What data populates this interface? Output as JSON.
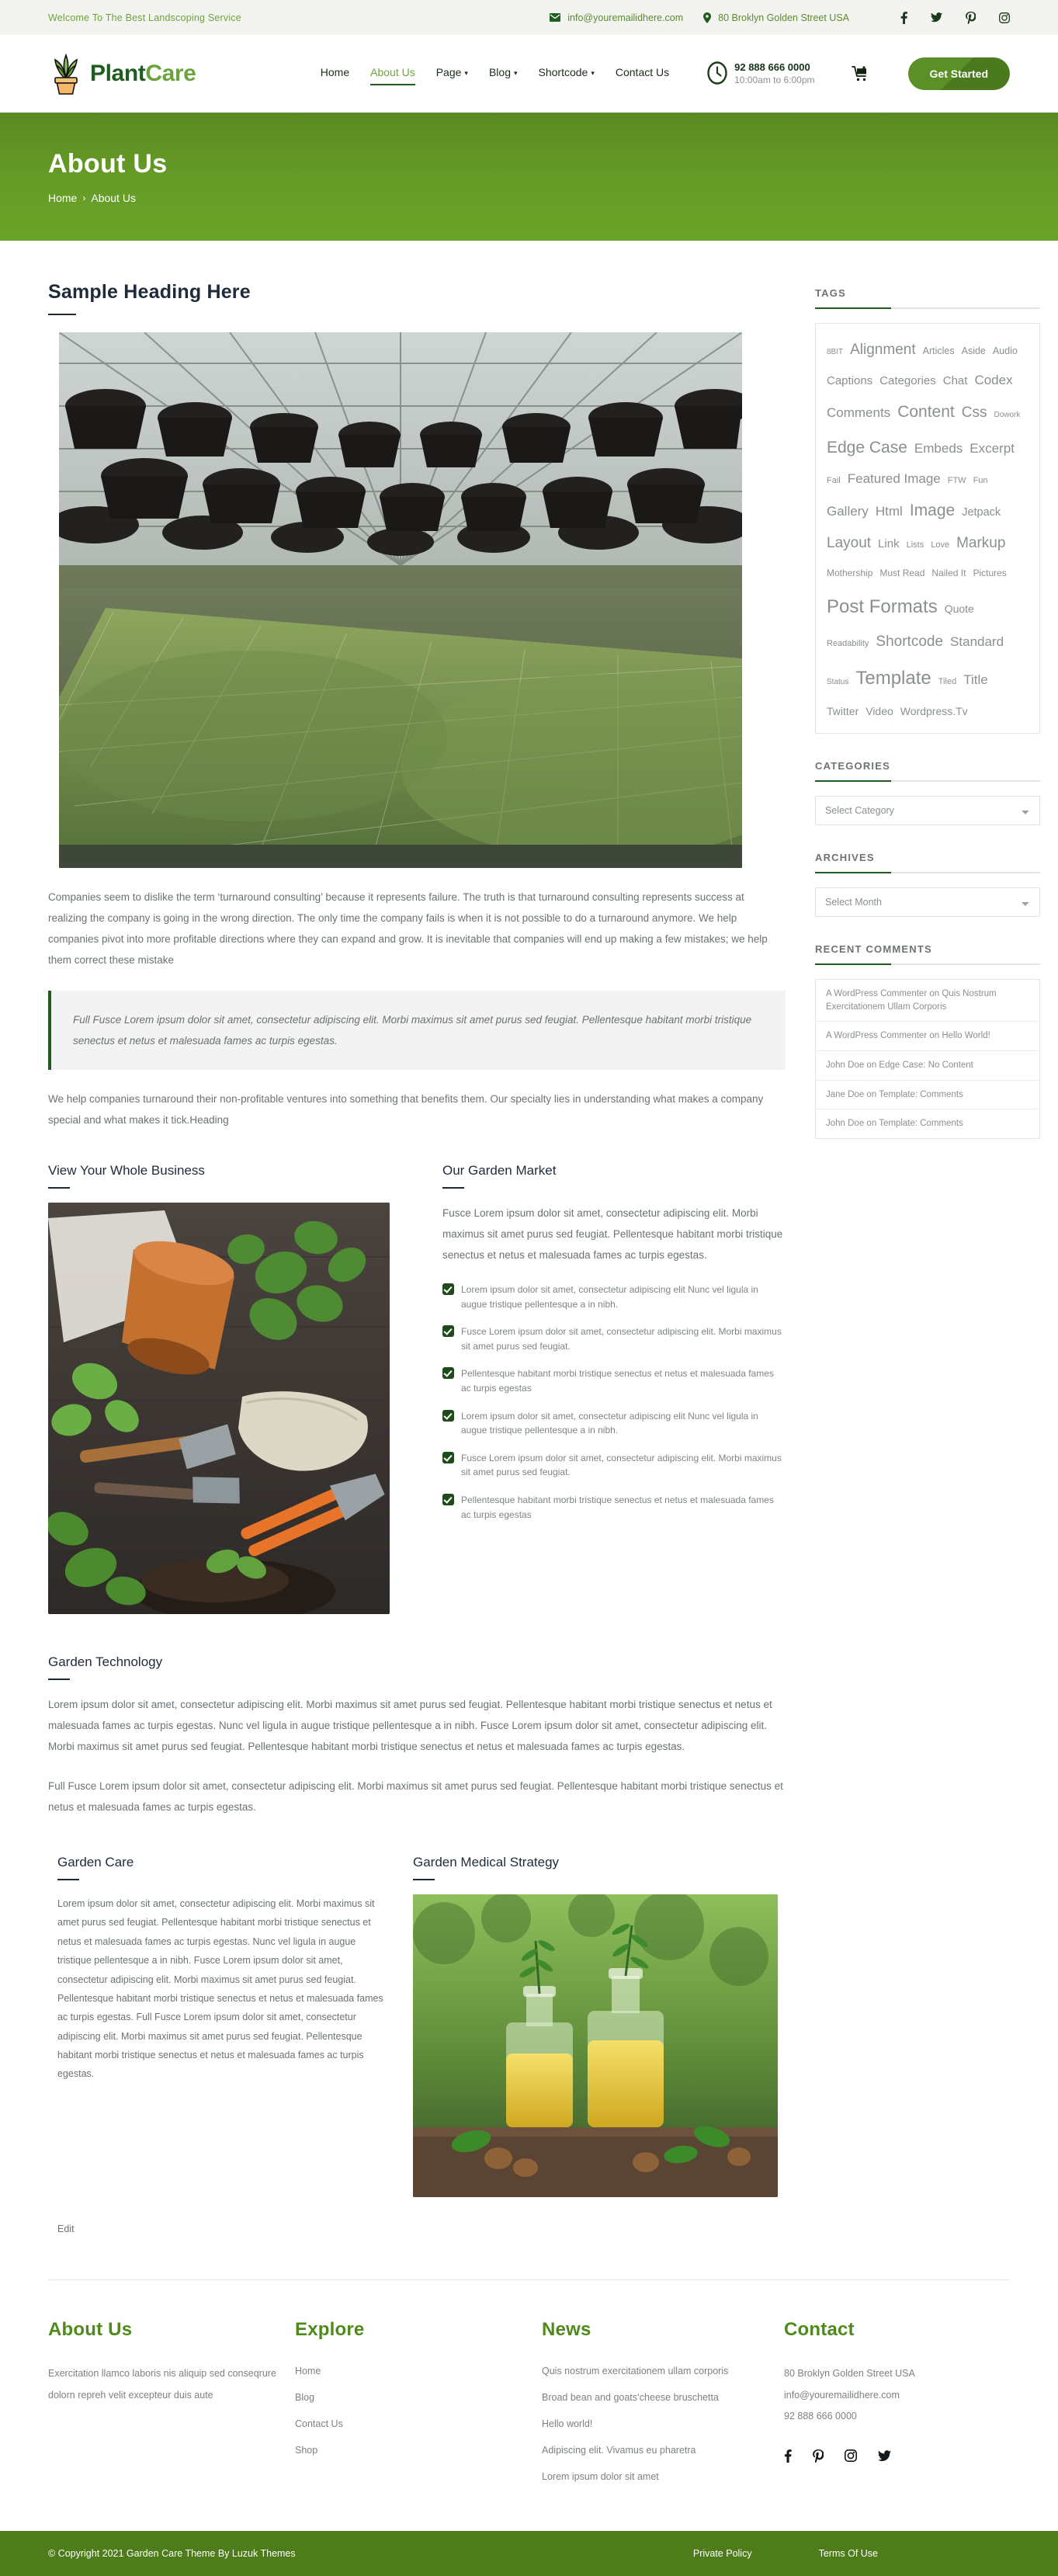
{
  "topbar": {
    "welcome": "Welcome To The Best Landscoping Service",
    "email": "info@youremailidhere.com",
    "address": "80 Broklyn Golden Street USA",
    "socials": [
      "facebook-icon",
      "twitter-icon",
      "pinterest-icon",
      "instagram-icon"
    ]
  },
  "header": {
    "logo_part1": "Plant",
    "logo_part2": "Care",
    "nav": [
      {
        "label": "Home",
        "has_caret": false,
        "active": false
      },
      {
        "label": "About Us",
        "has_caret": false,
        "active": true
      },
      {
        "label": "Page",
        "has_caret": true,
        "active": false
      },
      {
        "label": "Blog",
        "has_caret": true,
        "active": false
      },
      {
        "label": "Shortcode",
        "has_caret": true,
        "active": false
      },
      {
        "label": "Contact Us",
        "has_caret": false,
        "active": false
      }
    ],
    "phone": "92 888 666 0000",
    "hours": "10:00am to 6:00pm",
    "cta": "Get Started"
  },
  "banner": {
    "title": "About Us",
    "crumb_home": "Home",
    "crumb_sep": "›",
    "crumb_current": "About Us"
  },
  "main": {
    "heading": "Sample Heading Here",
    "paragraph1": "Companies seem to dislike the term ‘turnaround consulting’ because it represents failure. The truth is that turnaround consulting represents success at realizing the company is going in the wrong direction. The only time the company fails is when it is not possible to do a turnaround anymore. We help companies pivot into more profitable directions where they can expand and grow. It is inevitable that companies will end up making a few mistakes; we help them correct these mistake",
    "quote": "Full Fusce Lorem ipsum dolor sit amet, consectetur adipiscing elit. Morbi maximus sit amet purus sed feugiat. Pellentesque habitant morbi tristique senectus et netus et malesuada fames ac turpis egestas.",
    "paragraph2": "We help companies turnaround their non-profitable ventures into something that benefits them. Our specialty lies in understanding what makes a company special and what makes it tick.Heading",
    "col_left_title": "View Your Whole Business",
    "col_right_title": "Our Garden Market",
    "col_right_paragraph": "Fusce Lorem ipsum dolor sit amet, consectetur adipiscing elit. Morbi maximus sit amet purus sed feugiat. Pellentesque habitant morbi tristique senectus et netus et malesuada fames ac turpis egestas.",
    "checklist": [
      "Lorem ipsum dolor sit amet, consectetur adipiscing elit Nunc vel ligula in augue tristique pellentesque a in nibh.",
      "Fusce Lorem ipsum dolor sit amet, consectetur adipiscing elit. Morbi maximus sit amet purus sed feugiat.",
      "Pellentesque habitant morbi tristique senectus et netus et malesuada fames ac turpis egestas",
      "Lorem ipsum dolor sit amet, consectetur adipiscing elit Nunc vel ligula in augue tristique pellentesque a in nibh.",
      "Fusce Lorem ipsum dolor sit amet, consectetur adipiscing elit. Morbi maximus sit amet purus sed feugiat.",
      "Pellentesque habitant morbi tristique senectus et netus et malesuada fames ac turpis egestas"
    ],
    "tech_title": "Garden Technology",
    "tech_p1": "Lorem ipsum dolor sit amet, consectetur adipiscing elit. Morbi maximus sit amet purus sed feugiat. Pellentesque habitant morbi tristique senectus et netus et malesuada fames ac turpis egestas. Nunc vel ligula in augue tristique pellentesque a in nibh. Fusce Lorem ipsum dolor sit amet, consectetur adipiscing elit. Morbi maximus sit amet purus sed feugiat. Pellentesque habitant morbi tristique senectus et netus et malesuada fames ac turpis egestas.",
    "tech_p2": "Full Fusce Lorem ipsum dolor sit amet, consectetur adipiscing elit. Morbi maximus sit amet purus sed feugiat. Pellentesque habitant morbi tristique senectus et netus et malesuada fames ac turpis egestas.",
    "care_title": "Garden Care",
    "care_p": "Lorem ipsum dolor sit amet, consectetur adipiscing elit. Morbi maximus sit amet purus sed feugiat. Pellentesque habitant morbi tristique senectus et netus et malesuada fames ac turpis egestas. Nunc vel ligula in augue tristique pellentesque a in nibh. Fusce Lorem ipsum dolor sit amet, consectetur adipiscing elit. Morbi maximus sit amet purus sed feugiat. Pellentesque habitant morbi tristique senectus et netus et malesuada fames ac turpis egestas. Full Fusce Lorem ipsum dolor sit amet, consectetur adipiscing elit. Morbi maximus sit amet purus sed feugiat. Pellentesque habitant morbi tristique senectus et netus et malesuada fames ac turpis egestas.",
    "medical_title": "Garden Medical Strategy",
    "edit": "Edit"
  },
  "sidebar": {
    "tags_title": "TAGS",
    "tags": [
      {
        "label": "8BIT",
        "size": 10
      },
      {
        "label": "Alignment",
        "size": 19
      },
      {
        "label": "Articles",
        "size": 12.5
      },
      {
        "label": "Aside",
        "size": 12.5
      },
      {
        "label": "Audio",
        "size": 12.5
      },
      {
        "label": "Captions",
        "size": 15
      },
      {
        "label": "Categories",
        "size": 15
      },
      {
        "label": "Chat",
        "size": 15
      },
      {
        "label": "Codex",
        "size": 17
      },
      {
        "label": "Comments",
        "size": 17
      },
      {
        "label": "Content",
        "size": 21
      },
      {
        "label": "Css",
        "size": 19
      },
      {
        "label": "Dowork",
        "size": 10
      },
      {
        "label": "Edge Case",
        "size": 21
      },
      {
        "label": "Embeds",
        "size": 17
      },
      {
        "label": "Excerpt",
        "size": 17
      },
      {
        "label": "Fail",
        "size": 11
      },
      {
        "label": "Featured Image",
        "size": 17
      },
      {
        "label": "FTW",
        "size": 11
      },
      {
        "label": "Fun",
        "size": 11
      },
      {
        "label": "Gallery",
        "size": 17
      },
      {
        "label": "Html",
        "size": 17
      },
      {
        "label": "Image",
        "size": 21
      },
      {
        "label": "Jetpack",
        "size": 14.5
      },
      {
        "label": "Layout",
        "size": 19
      },
      {
        "label": "Link",
        "size": 15
      },
      {
        "label": "Lists",
        "size": 11
      },
      {
        "label": "Love",
        "size": 11
      },
      {
        "label": "Markup",
        "size": 19
      },
      {
        "label": "Mothership",
        "size": 12
      },
      {
        "label": "Must Read",
        "size": 12
      },
      {
        "label": "Nailed It",
        "size": 12
      },
      {
        "label": "Pictures",
        "size": 12
      },
      {
        "label": "Post Formats",
        "size": 24
      },
      {
        "label": "Quote",
        "size": 14
      },
      {
        "label": "Readability",
        "size": 11
      },
      {
        "label": "Shortcode",
        "size": 19
      },
      {
        "label": "Standard",
        "size": 17
      },
      {
        "label": "Status",
        "size": 10
      },
      {
        "label": "Template",
        "size": 24
      },
      {
        "label": "Tiled",
        "size": 11
      },
      {
        "label": "Title",
        "size": 17
      },
      {
        "label": "Twitter",
        "size": 14
      },
      {
        "label": "Video",
        "size": 14
      },
      {
        "label": "Wordpress.Tv",
        "size": 14
      }
    ],
    "categories_title": "CATEGORIES",
    "categories_selected": "Select Category",
    "archives_title": "ARCHIVES",
    "archives_selected": "Select Month",
    "recent_title": "RECENT COMMENTS",
    "recent_comments": [
      "A WordPress Commenter on Quis Nostrum Exercitationem Ullam Corporis",
      "A WordPress Commenter on Hello World!",
      "John Doe on Edge Case: No Content",
      "Jane Doe on Template: Comments",
      "John Doe on Template: Comments"
    ]
  },
  "footer": {
    "about_title": "About Us",
    "about_text": "Exercitation llamco laboris nis aliquip sed conseqrure dolorn repreh velit excepteur duis aute",
    "explore_title": "Explore",
    "explore_links": [
      "Home",
      "Blog",
      "Contact Us",
      "Shop"
    ],
    "news_title": "News",
    "news_links": [
      "Quis nostrum exercitationem ullam corporis",
      "Broad bean and goats‘cheese bruschetta",
      "Hello world!",
      "Adipiscing elit. Vivamus eu pharetra",
      "Lorem ipsum dolor sit amet"
    ],
    "contact_title": "Contact",
    "contact_address": "80 Broklyn Golden Street USA",
    "contact_email": "info@youremailidhere.com",
    "contact_phone": "92 888 666 0000",
    "socials": [
      "facebook-icon",
      "pinterest-icon",
      "instagram-icon",
      "twitter-icon"
    ],
    "copyright": "© Copyright 2021 Garden Care Theme By Luzuk Themes",
    "policy": "Private Policy",
    "terms": "Terms Of Use"
  },
  "colors": {
    "brand_green": "#6ba43c",
    "dark_green": "#1f5d1f",
    "banner_green": "#669c27",
    "copy_green": "#4e7c1a",
    "heading_navy": "#1f2b3a",
    "body_gray": "#6b7274"
  }
}
